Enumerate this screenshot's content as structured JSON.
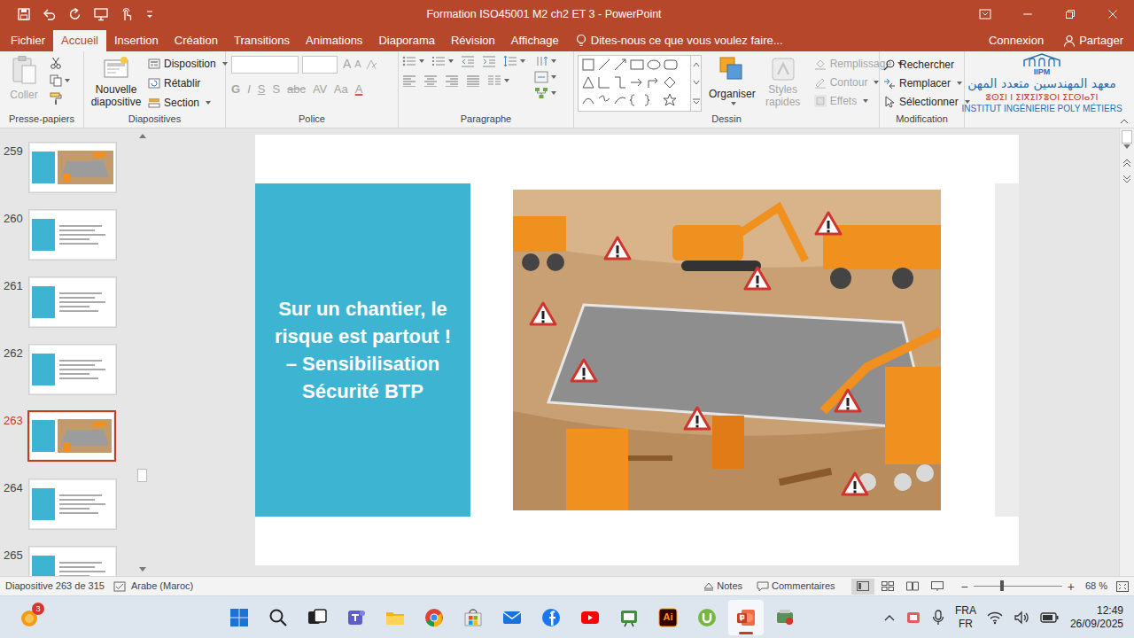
{
  "window": {
    "title": "Formation ISO45001 M2 ch2 ET 3 - PowerPoint"
  },
  "tabs": [
    {
      "label": "Fichier",
      "selected": false
    },
    {
      "label": "Accueil",
      "selected": true
    },
    {
      "label": "Insertion",
      "selected": false
    },
    {
      "label": "Création",
      "selected": false
    },
    {
      "label": "Transitions",
      "selected": false
    },
    {
      "label": "Animations",
      "selected": false
    },
    {
      "label": "Diaporama",
      "selected": false
    },
    {
      "label": "Révision",
      "selected": false
    },
    {
      "label": "Affichage",
      "selected": false
    }
  ],
  "tell_me": {
    "placeholder": "Dites-nous ce que vous voulez faire..."
  },
  "account": {
    "sign_in": "Connexion",
    "share": "Partager"
  },
  "ribbon": {
    "clipboard": {
      "label": "Presse-papiers",
      "paste": "Coller",
      "paste_disabled": true
    },
    "slides": {
      "label": "Diapositives",
      "new_slide": "Nouvelle diapositive",
      "layout": "Disposition",
      "reset": "Rétablir",
      "section": "Section"
    },
    "font": {
      "label": "Police",
      "disabled": true,
      "grow": "A",
      "shrink": "A",
      "styles": [
        "G",
        "I",
        "S",
        "S",
        "abc",
        "AV",
        "Aa",
        "A"
      ]
    },
    "paragraph": {
      "label": "Paragraphe"
    },
    "drawing": {
      "label": "Dessin",
      "arrange": "Organiser",
      "quick_styles": "Styles rapides",
      "fill": "Remplissage",
      "outline": "Contour",
      "effects": "Effets",
      "format_disabled": true
    },
    "editing": {
      "label": "Modification",
      "find": "Rechercher",
      "replace": "Remplacer",
      "select": "Sélectionner"
    }
  },
  "logo": {
    "acronym": "IIPM",
    "arabic": "معهد المهندسين متعدد المهن",
    "tifinagh": "ⵓⵙⵉⵏ ⵏ ⵉⵏⴳⵉⵏⵢⵓⵔⵏ ⵉⵎⵙⵏⴰⵢⵏ",
    "french": "INSTITUT INGÉNIERIE POLY MÉTIERS"
  },
  "thumbnails": [
    {
      "number": "259",
      "kind": "image",
      "selected": false
    },
    {
      "number": "260",
      "kind": "text",
      "selected": false
    },
    {
      "number": "261",
      "kind": "text",
      "selected": false
    },
    {
      "number": "262",
      "kind": "text",
      "selected": false
    },
    {
      "number": "263",
      "kind": "image",
      "selected": true
    },
    {
      "number": "264",
      "kind": "text",
      "selected": false
    },
    {
      "number": "265",
      "kind": "text",
      "selected": false
    }
  ],
  "thumbnail_scroll": 0.8,
  "slide": {
    "title": "Sur un chantier, le risque est partout ! – Sensibilisation Sécurité BTP"
  },
  "slide_scroll": 0.8,
  "status_bar": {
    "slide_info": "Diapositive 263 de 315",
    "language": "Arabe (Maroc)",
    "notes": "Notes",
    "comments": "Commentaires",
    "zoom_out": "−",
    "zoom_in": "+",
    "zoom": "68 %",
    "zoom_level": 0.32
  },
  "taskbar": {
    "badge": "3",
    "apps": [
      {
        "kind": "start",
        "active": false
      },
      {
        "kind": "search",
        "active": false
      },
      {
        "kind": "taskview",
        "active": false
      },
      {
        "kind": "teams",
        "active": false
      },
      {
        "kind": "explorer",
        "active": false
      },
      {
        "kind": "chrome",
        "active": false
      },
      {
        "kind": "store",
        "active": false
      },
      {
        "kind": "mail",
        "active": false
      },
      {
        "kind": "facebook",
        "active": false
      },
      {
        "kind": "youtube",
        "active": false
      },
      {
        "kind": "green",
        "active": false
      },
      {
        "kind": "illustrator",
        "active": false,
        "label": "Ai"
      },
      {
        "kind": "utorrent",
        "active": false
      },
      {
        "kind": "powerpoint",
        "active": true
      },
      {
        "kind": "other",
        "active": false
      }
    ],
    "input_lang": "FRA",
    "keyboard": "FR",
    "time": "12:49",
    "date": "26/09/2025"
  }
}
